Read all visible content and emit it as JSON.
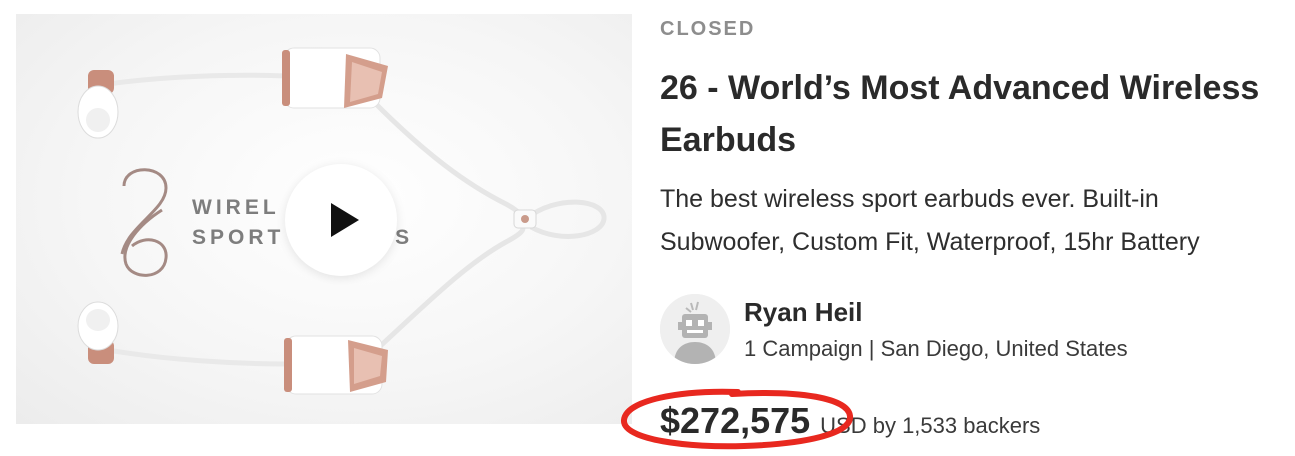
{
  "campaign": {
    "status": "CLOSED",
    "title": "26 - World’s Most Advanced Wireless Earbuds",
    "blurb": "The best wireless sport earbuds ever. Built-in Subwoofer, Custom Fit, Waterproof, 15hr Battery"
  },
  "media": {
    "brand_mark": "26",
    "brand_line1": "WIREL",
    "brand_line1_tail": "",
    "brand_line2": "SPORT",
    "brand_line2_tail": "DS",
    "play_icon": "play-icon"
  },
  "creator": {
    "name": "Ryan Heil",
    "meta": "1 Campaign | San Diego, United States",
    "avatar_icon": "robot-avatar-icon"
  },
  "funding": {
    "amount": "$272,575",
    "suffix": "USD by 1,533 backers",
    "highlight_color": "#e8281f"
  }
}
